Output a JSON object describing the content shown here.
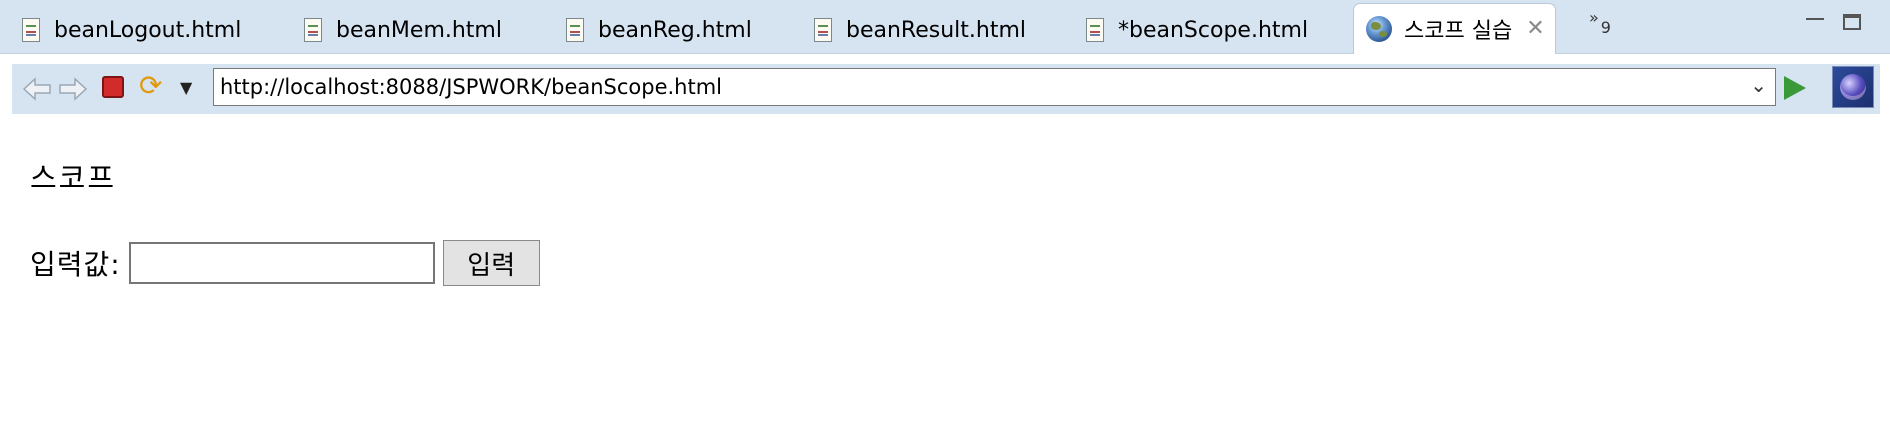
{
  "tabs": [
    {
      "label": "beanLogout.html"
    },
    {
      "label": "beanMem.html"
    },
    {
      "label": "beanReg.html"
    },
    {
      "label": "beanResult.html"
    },
    {
      "label": "*beanScope.html"
    },
    {
      "label": "스코프 실습",
      "active": true
    }
  ],
  "tab_overflow": {
    "symbol": "»",
    "count": "9"
  },
  "toolbar": {
    "url": "http://localhost:8088/JSPWORK/beanScope.html"
  },
  "page": {
    "heading": "스코프",
    "input_label": "입력값:",
    "input_value": "",
    "submit_label": "입력"
  },
  "icons": {
    "back": "back-arrow-icon",
    "forward": "forward-arrow-icon",
    "stop": "stop-icon",
    "refresh": "refresh-icon",
    "go": "go-icon",
    "browser": "eclipse-icon"
  },
  "colors": {
    "tabbar_bg": "#d6e3f0",
    "stop_red": "#d12b2b",
    "go_green": "#3a9a3a"
  }
}
